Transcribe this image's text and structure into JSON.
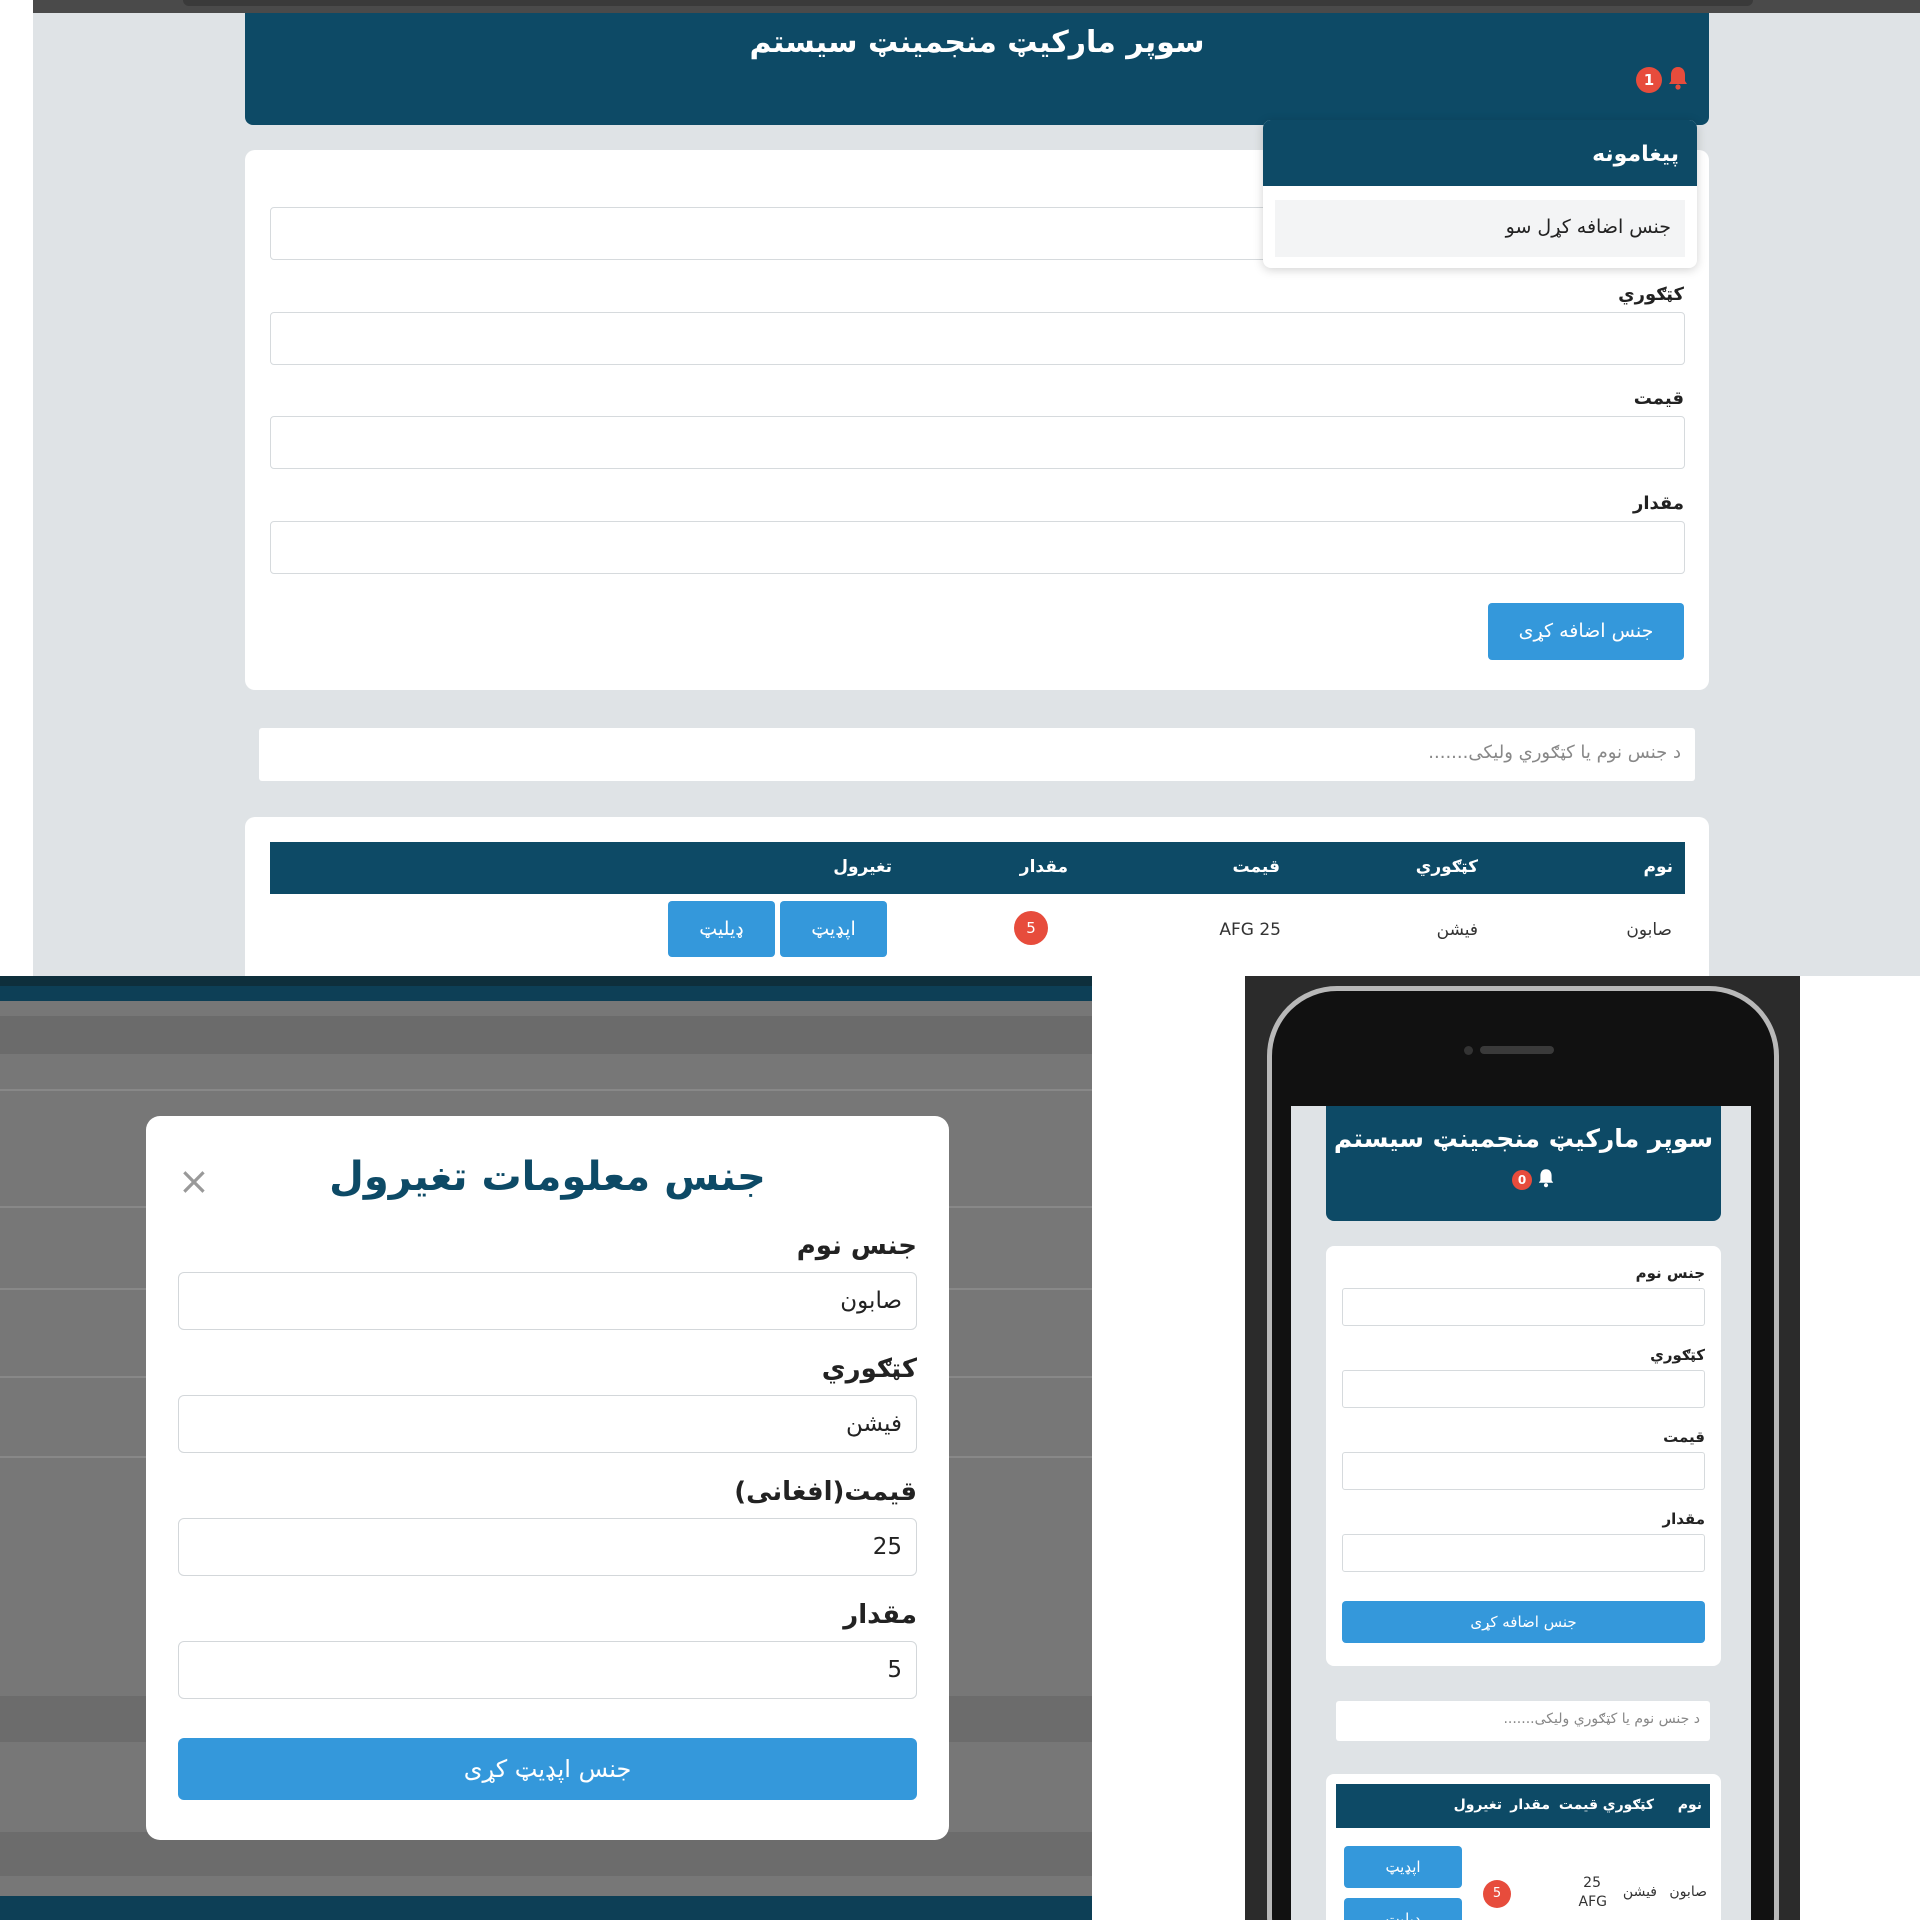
{
  "app_title": "سوپر مارکیټ منجمینټ سیستم",
  "notification_count_desktop": "1",
  "notification_count_mobile": "0",
  "notifications": {
    "title": "پیغامونه",
    "items": [
      "جنس اضافه کړل سو"
    ]
  },
  "form": {
    "category_label": "کټګوري",
    "price_label": "قیمت",
    "quantity_label": "مقدار",
    "name_label_mobile": "جنس نوم",
    "add_button": "جنس اضافه کړی"
  },
  "search": {
    "placeholder": "د جنس نوم یا کټګوري ولیکی......."
  },
  "table": {
    "headers": {
      "name": "نوم",
      "category": "کټګوري",
      "price": "قیمت",
      "quantity": "مقدار",
      "actions": "تغیرول"
    },
    "rows": [
      {
        "name": "صابون",
        "category": "فیشن",
        "price": "AFG 25",
        "quantity": "5"
      }
    ],
    "edit_button": "اپډیټ",
    "delete_button": "ډیلیټ",
    "mobile_price_amount": "25",
    "mobile_price_currency": "AFG"
  },
  "modal": {
    "title": "جنس معلومات تغیرول",
    "close_symbol": "×",
    "name_label": "جنس نوم",
    "name_value": "صابون",
    "category_label": "کټګوري",
    "category_value": "فیشن",
    "price_label": "قیمت(افغانی)",
    "price_value": "25",
    "quantity_label": "مقدار",
    "quantity_value": "5",
    "update_button": "جنس اپډیټ کړی"
  },
  "colors": {
    "header": "#0d4a66",
    "primary": "#3498db",
    "badge": "#e74c3c",
    "background": "#dfe3e6"
  },
  "icons": [
    "bell-icon",
    "close-icon"
  ]
}
